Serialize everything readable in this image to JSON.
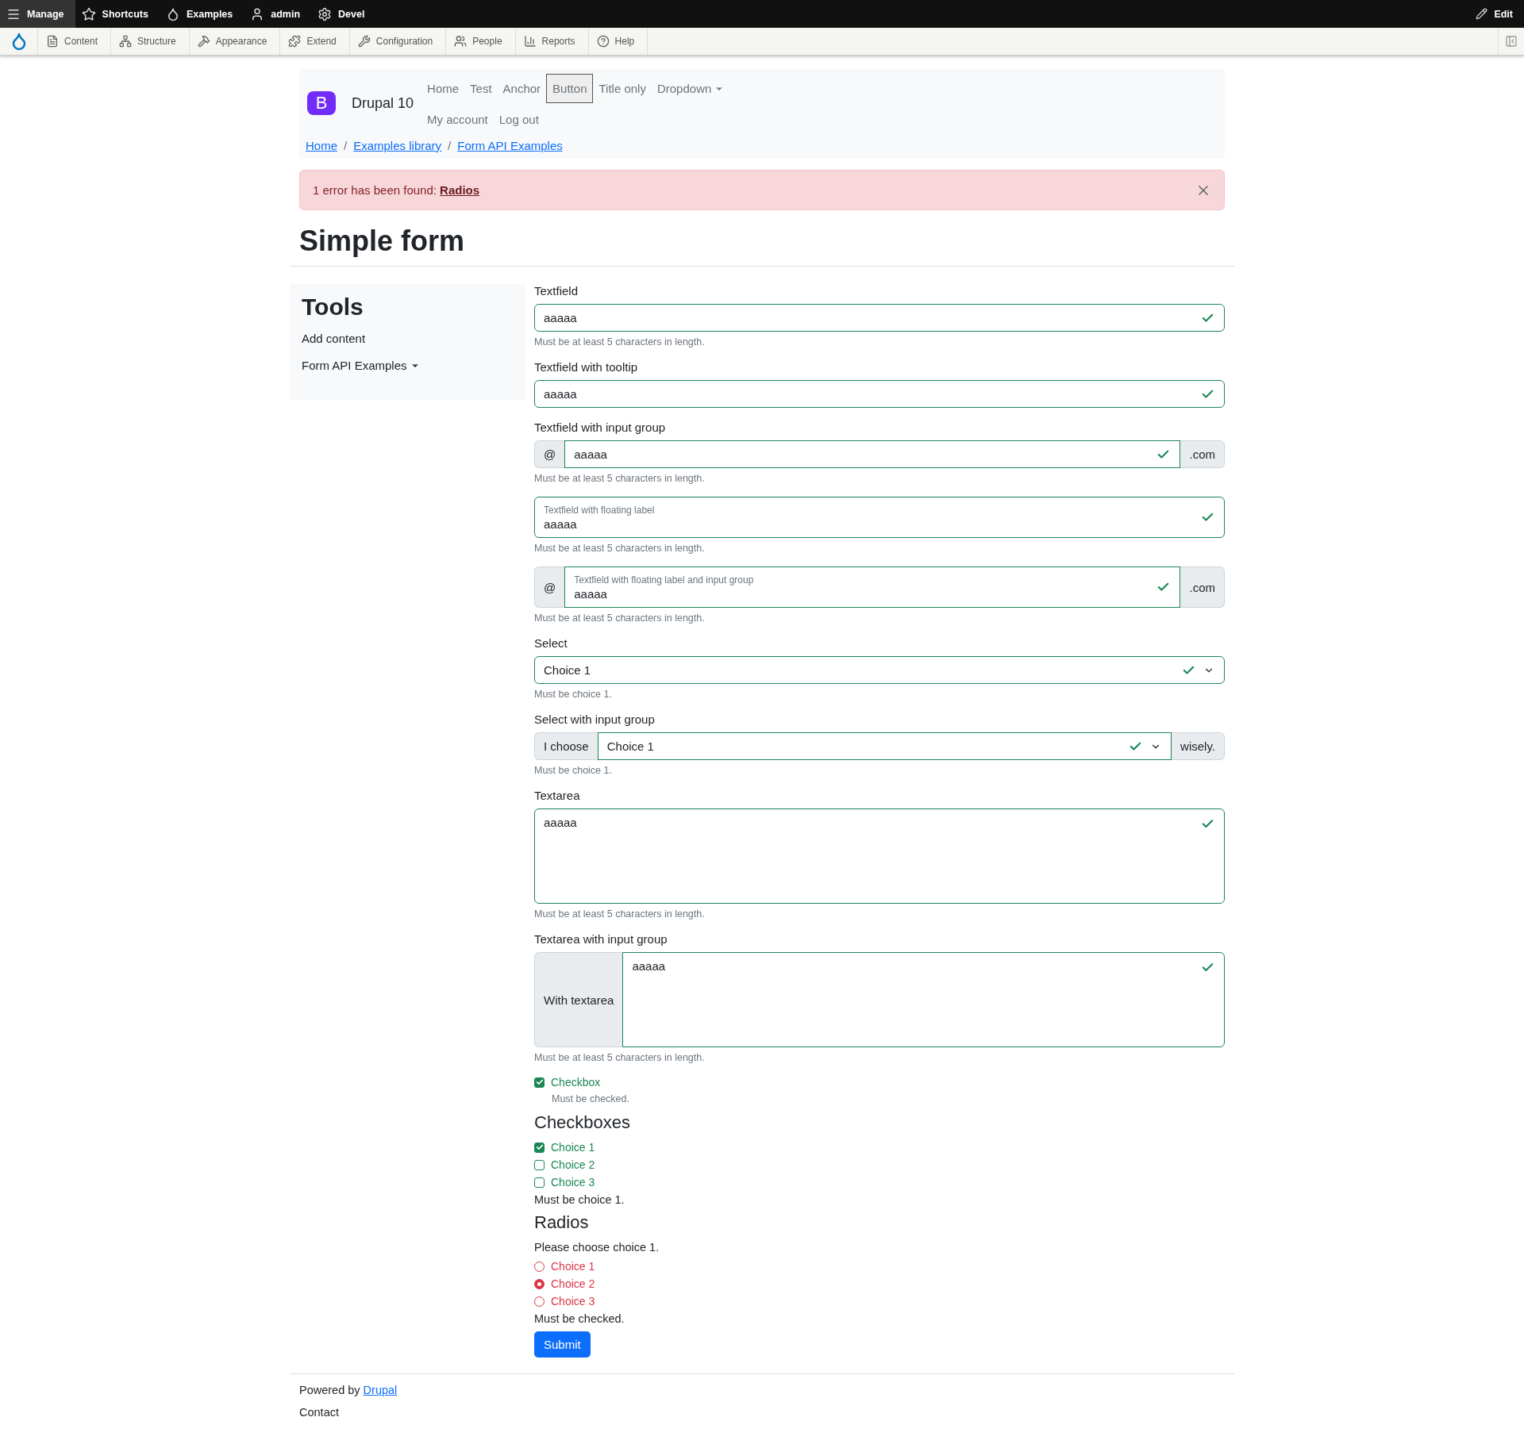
{
  "admin_toolbar": {
    "items": [
      {
        "label": "Manage",
        "selected": true
      },
      {
        "label": "Shortcuts",
        "selected": false
      },
      {
        "label": "Examples",
        "selected": false
      },
      {
        "label": "admin",
        "selected": false
      },
      {
        "label": "Devel",
        "selected": false
      }
    ],
    "edit": "Edit"
  },
  "admin_tray": {
    "items": [
      "Content",
      "Structure",
      "Appearance",
      "Extend",
      "Configuration",
      "People",
      "Reports",
      "Help"
    ]
  },
  "site": {
    "logo_letter": "B",
    "name": "Drupal 10",
    "nav": [
      {
        "label": "Home",
        "kind": "link"
      },
      {
        "label": "Test",
        "kind": "link"
      },
      {
        "label": "Anchor",
        "kind": "link"
      },
      {
        "label": "Button",
        "kind": "button"
      },
      {
        "label": "Title only",
        "kind": "link"
      },
      {
        "label": "Dropdown",
        "kind": "dropdown"
      }
    ],
    "account_nav": [
      "My account",
      "Log out"
    ]
  },
  "breadcrumb": {
    "separator": "/",
    "items": [
      "Home",
      "Examples library",
      "Form API Examples"
    ]
  },
  "alert": {
    "text": "1 error has been found: ",
    "link": "Radios"
  },
  "page_title": "Simple form",
  "sidebar": {
    "title": "Tools",
    "items": [
      {
        "label": "Add content",
        "kind": "link"
      },
      {
        "label": "Form API Examples",
        "kind": "dropdown"
      }
    ]
  },
  "fields": [
    {
      "kind": "text",
      "label": "Textfield",
      "value": "aaaaa",
      "help": "Must be at least 5 characters in length."
    },
    {
      "kind": "text",
      "label": "Textfield with tooltip",
      "value": "aaaaa"
    },
    {
      "kind": "input_group",
      "label": "Textfield with input group",
      "prefix": "@",
      "value": "aaaaa",
      "suffix": ".com",
      "help": "Must be at least 5 characters in length."
    },
    {
      "kind": "floating",
      "label": "Textfield with floating label",
      "value": "aaaaa",
      "help": "Must be at least 5 characters in length."
    },
    {
      "kind": "floating_group",
      "prefix": "@",
      "label": "Textfield with floating label and input group",
      "value": "aaaaa",
      "suffix": ".com",
      "help": "Must be at least 5 characters in length."
    },
    {
      "kind": "select",
      "label": "Select",
      "value": "Choice 1",
      "help": "Must be choice 1."
    },
    {
      "kind": "select_group",
      "label": "Select with input group",
      "prefix": "I choose",
      "value": "Choice 1",
      "suffix": "wisely.",
      "help": "Must be choice 1."
    },
    {
      "kind": "textarea",
      "label": "Textarea",
      "value": "aaaaa",
      "help": "Must be at least 5 characters in length."
    },
    {
      "kind": "textarea_group",
      "label": "Textarea with input group",
      "prefix": "With textarea",
      "value": "aaaaa",
      "help": "Must be at least 5 characters in length."
    }
  ],
  "checkbox": {
    "label": "Checkbox",
    "checked": true,
    "help": "Must be checked."
  },
  "checkboxes": {
    "title": "Checkboxes",
    "valid": true,
    "items": [
      {
        "label": "Choice 1",
        "checked": true
      },
      {
        "label": "Choice 2",
        "checked": false
      },
      {
        "label": "Choice 3",
        "checked": false
      }
    ],
    "help": "Must be choice 1."
  },
  "radios": {
    "title": "Radios",
    "valid": false,
    "description": "Please choose choice 1.",
    "items": [
      {
        "label": "Choice 1",
        "selected": false
      },
      {
        "label": "Choice 2",
        "selected": true
      },
      {
        "label": "Choice 3",
        "selected": false
      }
    ],
    "help": "Must be checked."
  },
  "submit": "Submit",
  "footer": {
    "text": "Powered by ",
    "link": "Drupal",
    "contact": "Contact"
  }
}
